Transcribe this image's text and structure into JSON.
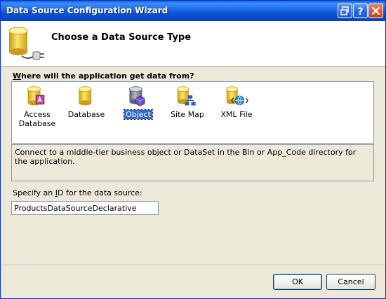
{
  "window": {
    "title": "Data Source Configuration Wizard"
  },
  "header": {
    "title": "Choose a Data Source Type",
    "icon": "database-plug-icon"
  },
  "question": {
    "label": "Where will the application get data from?"
  },
  "data_sources": [
    {
      "label_lines": [
        "Access",
        "Database"
      ],
      "icon": "access-database-icon",
      "selected": false
    },
    {
      "label_lines": [
        "Database"
      ],
      "icon": "database-icon",
      "selected": false
    },
    {
      "label_lines": [
        "Object"
      ],
      "icon": "object-icon",
      "selected": true
    },
    {
      "label_lines": [
        "Site Map"
      ],
      "icon": "site-map-icon",
      "selected": false
    },
    {
      "label_lines": [
        "XML File"
      ],
      "icon": "xml-file-icon",
      "selected": false
    }
  ],
  "description": "Connect to a middle-tier business object or DataSet in the Bin or App_Code directory for the application.",
  "id_field": {
    "label": "Specify an ID for the data source:",
    "value": "ProductsDataSourceDeclarative"
  },
  "buttons": {
    "ok": "OK",
    "cancel": "Cancel"
  },
  "colors": {
    "title_bar": "#0b56d6",
    "selection": "#316ac5",
    "dialog_bg": "#ece9d8"
  }
}
